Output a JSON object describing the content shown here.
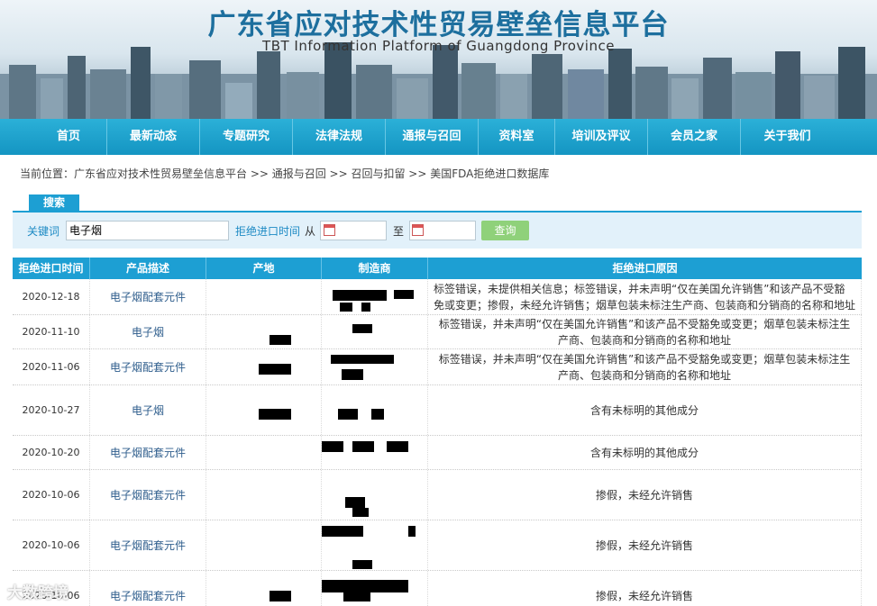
{
  "header": {
    "title_cn": "广东省应对技术性贸易壁垒信息平台",
    "title_en": "TBT Information Platform of Guangdong Province"
  },
  "nav": [
    "首页",
    "最新动态",
    "专题研究",
    "法律法规",
    "通报与召回",
    "资料室",
    "培训及评议",
    "会员之家",
    "关于我们"
  ],
  "breadcrumb": "当前位置：广东省应对技术性贸易壁垒信息平台 >> 通报与召回 >> 召回与扣留 >> 美国FDA拒绝进口数据库",
  "search": {
    "tab_label": "搜索",
    "keyword_label": "关键词",
    "keyword_value": "电子烟",
    "date_label": "拒绝进口时间",
    "from_label": "从",
    "to_label": "至",
    "query_button": "查询"
  },
  "table": {
    "columns": [
      "拒绝进口时间",
      "产品描述",
      "产地",
      "制造商",
      "拒绝进口原因"
    ],
    "rows": [
      {
        "date": "2020-12-18",
        "product": "电子烟配套元件",
        "reason": "标签错误，未提供相关信息；标签错误，并未声明“仅在美国允许销售”和该产品不受豁免或变更；掺假，未经允许销售；烟草包装未标注生产商、包装商和分销商的名称和地址"
      },
      {
        "date": "2020-11-10",
        "product": "电子烟",
        "reason": "标签错误，并未声明“仅在美国允许销售”和该产品不受豁免或变更；烟草包装未标注生产商、包装商和分销商的名称和地址"
      },
      {
        "date": "2020-11-06",
        "product": "电子烟配套元件",
        "reason": "标签错误，并未声明“仅在美国允许销售”和该产品不受豁免或变更；烟草包装未标注生产商、包装商和分销商的名称和地址"
      },
      {
        "date": "2020-10-27",
        "product": "电子烟",
        "reason": "含有未标明的其他成分"
      },
      {
        "date": "2020-10-20",
        "product": "电子烟配套元件",
        "reason": "含有未标明的其他成分"
      },
      {
        "date": "2020-10-06",
        "product": "电子烟配套元件",
        "reason": "掺假，未经允许销售"
      },
      {
        "date": "2020-10-06",
        "product": "电子烟配套元件",
        "reason": "掺假，未经允许销售"
      },
      {
        "date": "2020-10-06",
        "product": "电子烟配套元件",
        "reason": "掺假，未经允许销售"
      }
    ]
  },
  "watermark": "大数跨境"
}
